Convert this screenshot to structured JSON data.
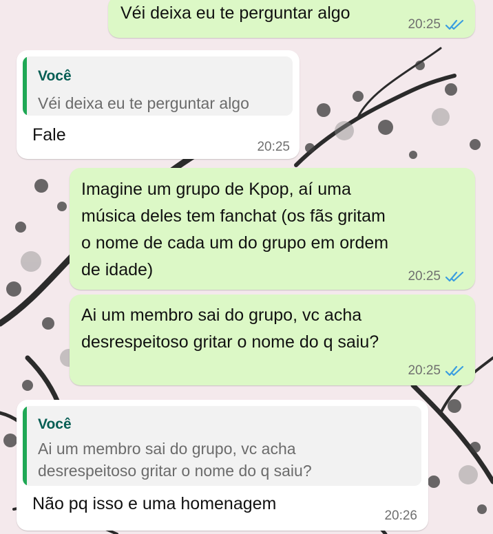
{
  "theme": {
    "outgoing_bubble": "#dcf8c6",
    "incoming_bubble": "#ffffff",
    "quote_accent": "#1fa855",
    "read_ticks": "#3a9de0",
    "wallpaper": "plum blossom ink painting"
  },
  "messages": [
    {
      "direction": "outgoing",
      "text": "Véi deixa eu te perguntar algo",
      "time": "20:25",
      "status": "read"
    },
    {
      "direction": "incoming",
      "reply_to": {
        "author": "Você",
        "text": "Véi deixa eu te perguntar algo"
      },
      "text": "Fale",
      "time": "20:25"
    },
    {
      "direction": "outgoing",
      "lines": [
        "Imagine um grupo de Kpop, aí uma",
        "música deles tem fanchat (os fãs gritam",
        "o nome de cada um do grupo em ordem",
        "de idade)"
      ],
      "time": "20:25",
      "status": "read"
    },
    {
      "direction": "outgoing",
      "lines": [
        "Ai um membro sai do grupo, vc acha",
        "desrespeitoso gritar o nome do q saiu?"
      ],
      "time": "20:25",
      "status": "read"
    },
    {
      "direction": "incoming",
      "reply_to": {
        "author": "Você",
        "lines": [
          "Ai um membro sai do grupo, vc acha",
          "desrespeitoso gritar o nome do q saiu?"
        ]
      },
      "text": "Não pq isso e uma homenagem",
      "time": "20:26"
    }
  ]
}
